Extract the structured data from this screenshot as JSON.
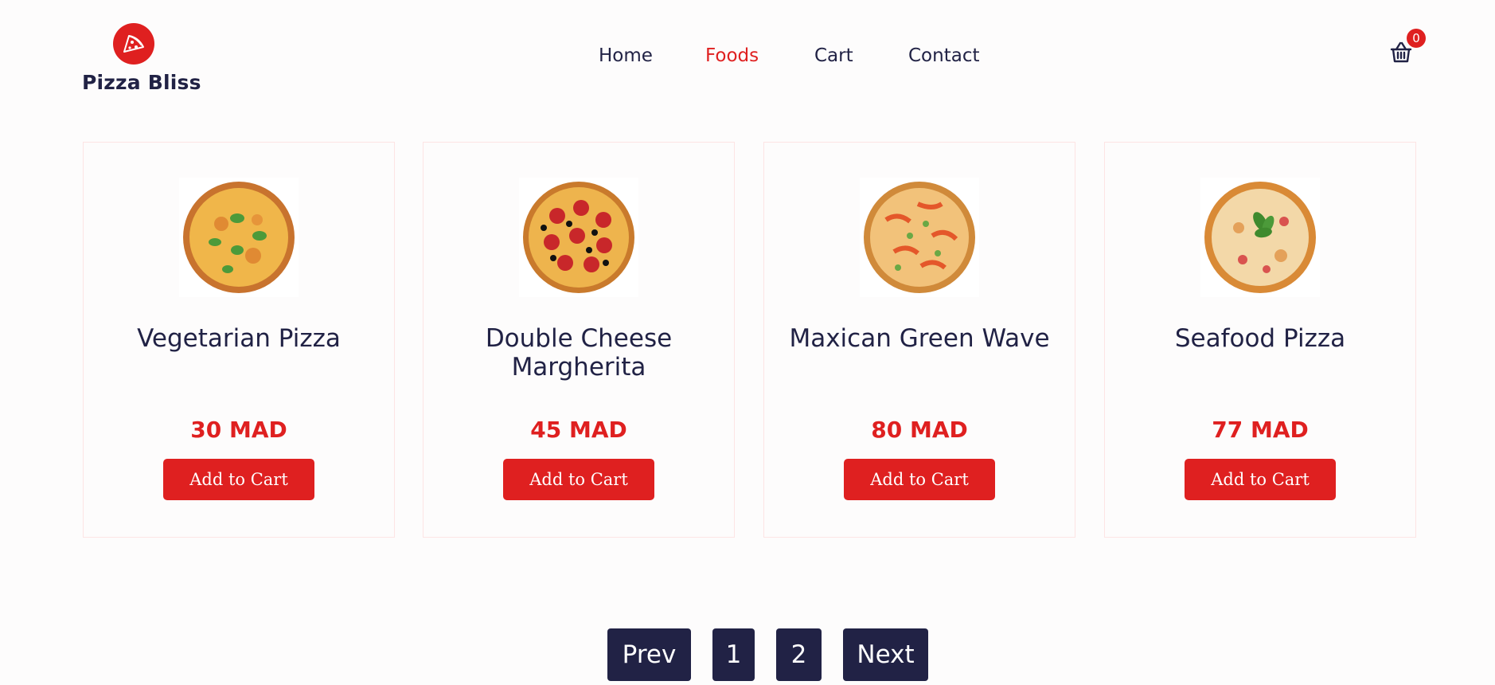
{
  "brand": {
    "name": "Pizza Bliss",
    "logo_icon": "pizza-slice-icon"
  },
  "nav": {
    "items": [
      {
        "label": "Home",
        "active": false
      },
      {
        "label": "Foods",
        "active": true
      },
      {
        "label": "Cart",
        "active": false
      },
      {
        "label": "Contact",
        "active": false
      }
    ]
  },
  "cart": {
    "icon": "basket-icon",
    "count": "0"
  },
  "products": [
    {
      "name": "Vegetarian Pizza",
      "price": "30 MAD",
      "button": "Add to Cart",
      "image": "vegetarian-pizza-image"
    },
    {
      "name": "Double Cheese Margherita",
      "price": "45 MAD",
      "button": "Add to Cart",
      "image": "pepperoni-pizza-image"
    },
    {
      "name": "Maxican Green Wave",
      "price": "80 MAD",
      "button": "Add to Cart",
      "image": "mexican-pizza-image"
    },
    {
      "name": "Seafood Pizza",
      "price": "77 MAD",
      "button": "Add to Cart",
      "image": "seafood-pizza-image"
    }
  ],
  "pagination": {
    "prev": "Prev",
    "pages": [
      "1",
      "2"
    ],
    "next": "Next"
  },
  "colors": {
    "accent": "#df2020",
    "dark": "#212245",
    "background": "#fdfcfc",
    "card_border": "#fde4e4"
  }
}
